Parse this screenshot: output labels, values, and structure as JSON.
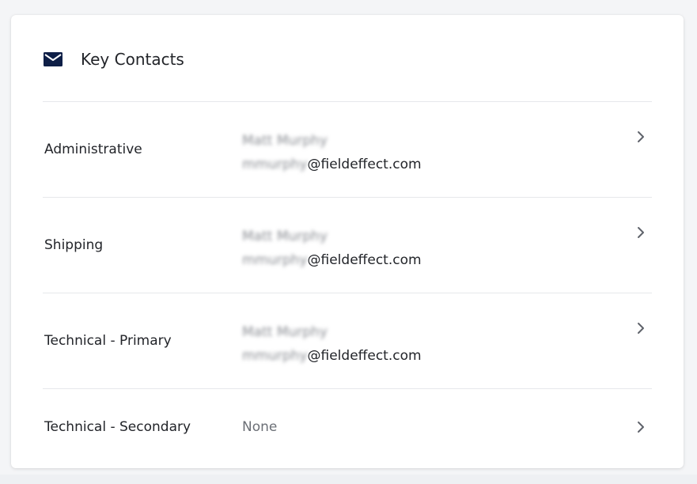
{
  "card": {
    "title": "Key Contacts",
    "icon": "mail-icon",
    "accent_color": "#0e1f47"
  },
  "contacts": [
    {
      "label": "Administrative",
      "name": "Matt Murphy",
      "email_user": "mmurphy",
      "email_domain": "@fieldeffect.com"
    },
    {
      "label": "Shipping",
      "name": "Matt Murphy",
      "email_user": "mmurphy",
      "email_domain": "@fieldeffect.com"
    },
    {
      "label": "Technical - Primary",
      "name": "Matt Murphy",
      "email_user": "mmurphy",
      "email_domain": "@fieldeffect.com"
    },
    {
      "label": "Technical - Secondary",
      "value": "None"
    }
  ]
}
